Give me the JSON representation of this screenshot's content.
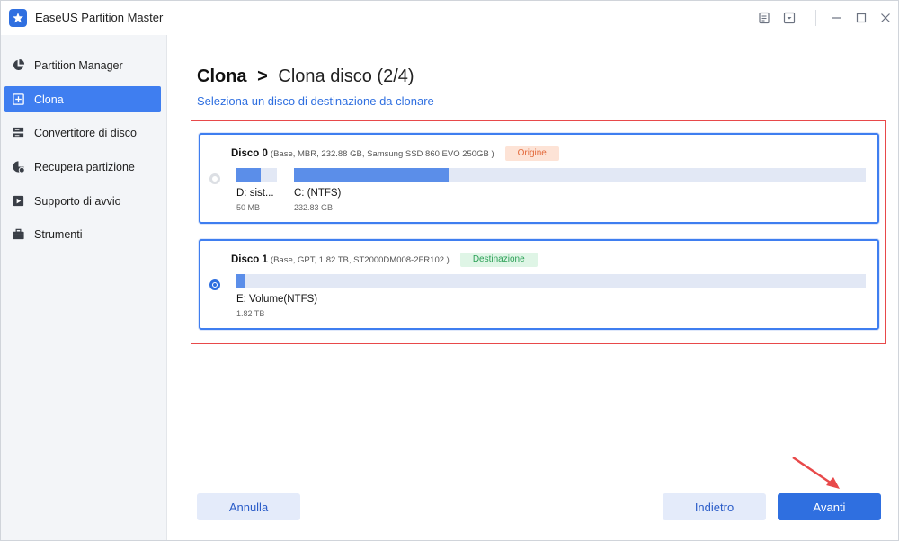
{
  "app": {
    "title": "EaseUS Partition Master"
  },
  "sidebar": {
    "items": [
      {
        "label": "Partition Manager",
        "icon": "pie-chart-icon",
        "active": false
      },
      {
        "label": "Clona",
        "icon": "clone-icon",
        "active": true
      },
      {
        "label": "Convertitore di disco",
        "icon": "convert-icon",
        "active": false
      },
      {
        "label": "Recupera partizione",
        "icon": "recover-icon",
        "active": false
      },
      {
        "label": "Supporto di avvio",
        "icon": "bootable-media-icon",
        "active": false
      },
      {
        "label": "Strumenti",
        "icon": "toolbox-icon",
        "active": false
      }
    ]
  },
  "main": {
    "heading_strong": "Clona",
    "heading_sep": ">",
    "heading_light": "Clona disco (2/4)",
    "subheading": "Seleziona un disco di destinazione da clonare",
    "disks": [
      {
        "name": "Disco 0",
        "info": "(Base, MBR, 232.88 GB, Samsung SSD 860 EVO 250GB )",
        "tag": "Origine",
        "selected": false,
        "partitions": [
          {
            "name": "D: sist...",
            "size": "50 MB",
            "used_fraction": 0.6
          },
          {
            "name": "C: (NTFS)",
            "size": "232.83 GB",
            "used_fraction": 0.27
          }
        ]
      },
      {
        "name": "Disco 1",
        "info": "(Base, GPT, 1.82 TB, ST2000DM008-2FR102 )",
        "tag": "Destinazione",
        "selected": true,
        "partitions": [
          {
            "name": "E: Volume(NTFS)",
            "size": "1.82 TB",
            "used_fraction": 0.013
          }
        ]
      }
    ]
  },
  "footer": {
    "cancel_label": "Annulla",
    "back_label": "Indietro",
    "next_label": "Avanti"
  },
  "colors": {
    "accent": "#2f6fe0",
    "active_sidebar": "#3f7ef0",
    "origin_tag": "#e2693b",
    "dest_tag": "#2aa055",
    "highlight": "#e8494a"
  }
}
